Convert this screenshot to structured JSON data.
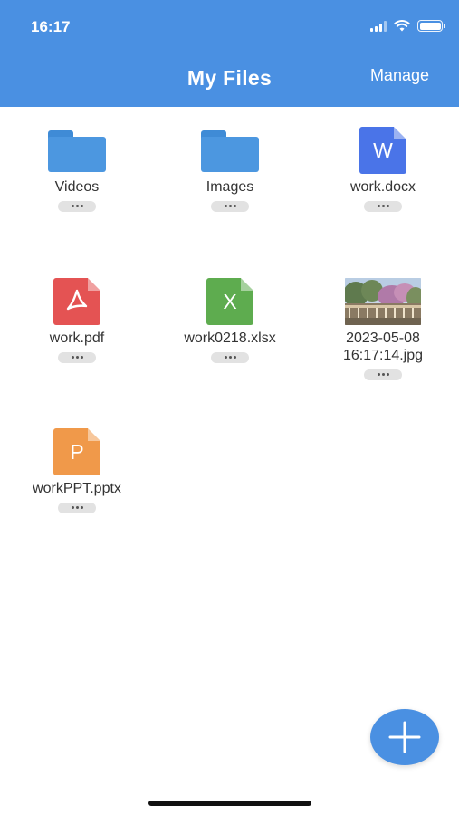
{
  "status_bar": {
    "time": "16:17"
  },
  "header": {
    "title": "My Files",
    "manage_label": "Manage"
  },
  "files": [
    {
      "name": "Videos",
      "type": "folder-icon"
    },
    {
      "name": "Images",
      "type": "folder-icon"
    },
    {
      "name": "work.docx",
      "type": "word-document-icon",
      "color": "#4a74e8",
      "glyph": "W"
    },
    {
      "name": "work.pdf",
      "type": "pdf-document-icon",
      "color": "#e45353"
    },
    {
      "name": "work0218.xlsx",
      "type": "excel-document-icon",
      "color": "#5eac4f",
      "glyph": "X"
    },
    {
      "name": "2023-05-08 16:17:14.jpg",
      "name_line1": "2023-05-08",
      "name_line2": "16:17:14.jpg",
      "type": "image-thumbnail"
    },
    {
      "name": "workPPT.pptx",
      "type": "powerpoint-document-icon",
      "color": "#f0994a",
      "glyph": "P"
    }
  ],
  "more_button": {
    "icon": "ellipsis-icon"
  },
  "fab": {
    "icon": "plus-icon"
  },
  "colors": {
    "accent": "#4a90e2",
    "folder": "#4c97e0"
  }
}
